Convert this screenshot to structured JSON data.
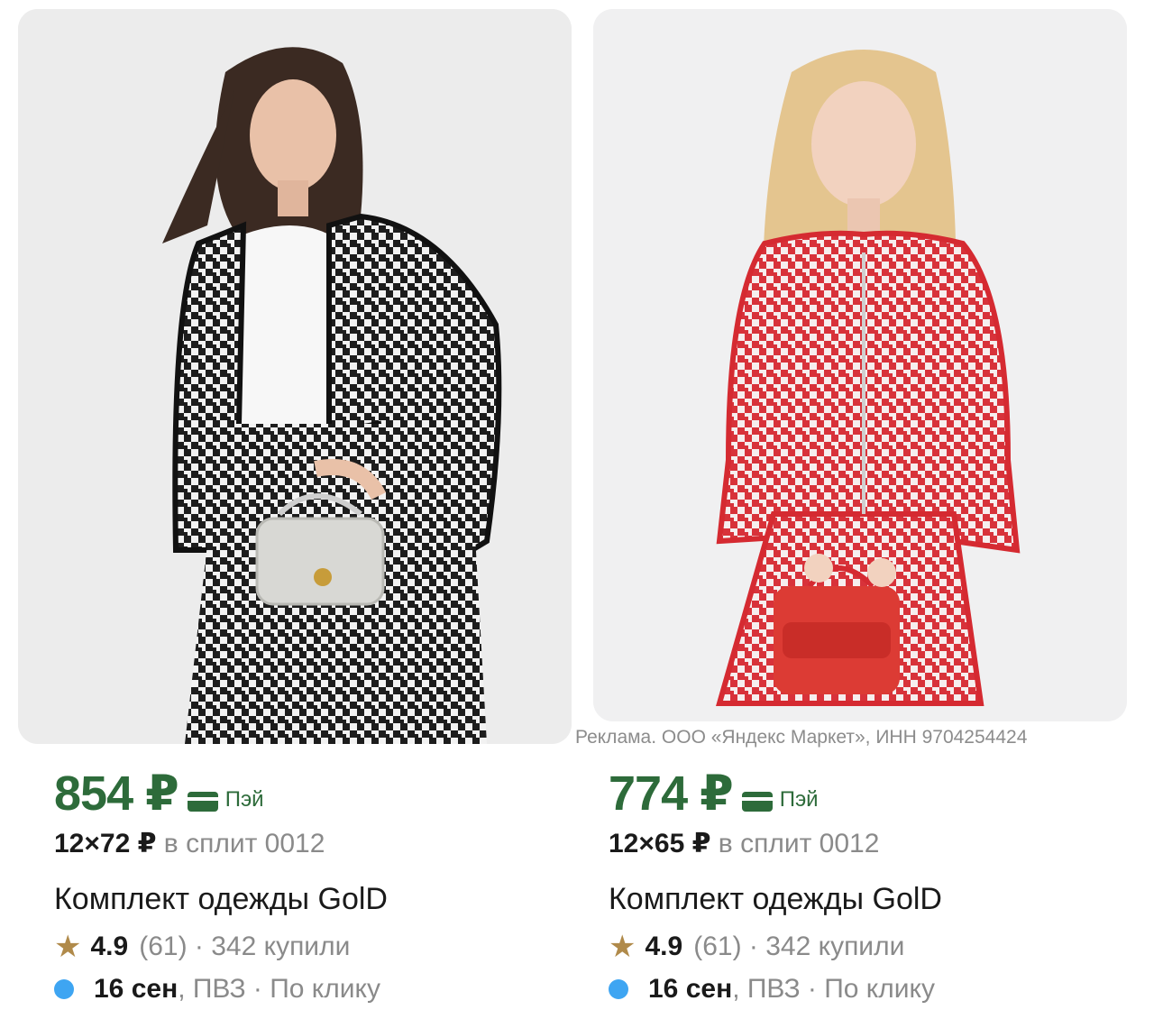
{
  "ad_notice": "Реклама. ООО «Яндекс Маркет», ИНН 9704254424",
  "colors": {
    "price": "#2d6b3a",
    "star": "#b08a4a",
    "delivery_dot": "#3ea5f2"
  },
  "products": [
    {
      "price": "854 ₽",
      "pay_label": "Пэй",
      "split_amount": "12×72 ₽",
      "split_text": " в сплит 0012",
      "title": "Комплект одежды GolD",
      "rating": "4.9",
      "rating_meta": "(61) · 342 купили",
      "delivery_date": "16 сен",
      "delivery_meta": ", ПВЗ · По клику",
      "icons": {
        "rating": "star-icon",
        "delivery": "dot-icon",
        "pay": "card-icon"
      }
    },
    {
      "price": "774 ₽",
      "pay_label": "Пэй",
      "split_amount": "12×65 ₽",
      "split_text": " в сплит 0012",
      "title": "Комплект одежды GolD",
      "rating": "4.9",
      "rating_meta": "(61) · 342 купили",
      "delivery_date": "16 сен",
      "delivery_meta": ", ПВЗ · По клику",
      "icons": {
        "rating": "star-icon",
        "delivery": "dot-icon",
        "pay": "card-icon"
      }
    }
  ]
}
